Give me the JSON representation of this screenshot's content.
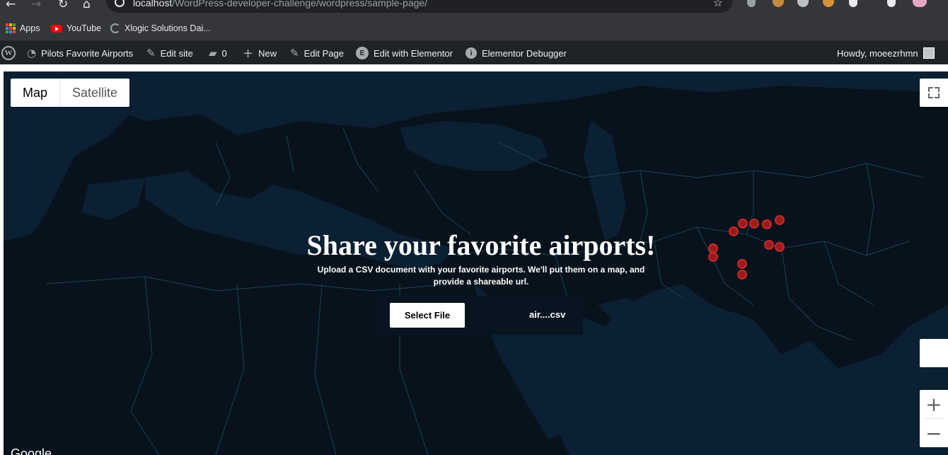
{
  "browser": {
    "url_host": "localhost",
    "url_path": "/WordPress-developer-challenge/wordpress/sample-page/",
    "bookmarks": [
      {
        "label": "Apps",
        "icon": "apps-grid-icon"
      },
      {
        "label": "YouTube",
        "icon": "youtube-icon"
      },
      {
        "label": "Xlogic Solutions Dai...",
        "icon": "xlogic-icon"
      }
    ]
  },
  "adminbar": {
    "site_name": "Pilots Favorite Airports",
    "edit_site": "Edit site",
    "comments_count": "0",
    "new": "New",
    "edit_page": "Edit Page",
    "edit_elementor": "Edit with Elementor",
    "debugger": "Elementor Debugger",
    "howdy": "Howdy, moeezrhmn"
  },
  "map": {
    "type_map": "Map",
    "type_satellite": "Satellite",
    "zoom_in": "+",
    "zoom_out": "−",
    "attribution": "Google",
    "marker_count": 12,
    "marker_color": "#9b1b1b"
  },
  "hero": {
    "title": "Share your favorite airports!",
    "description": "Upload a CSV document with your favorite airports. We'll put them on a map, and provide a shareable url.",
    "select_button": "Select File",
    "file_name": "air....csv"
  }
}
